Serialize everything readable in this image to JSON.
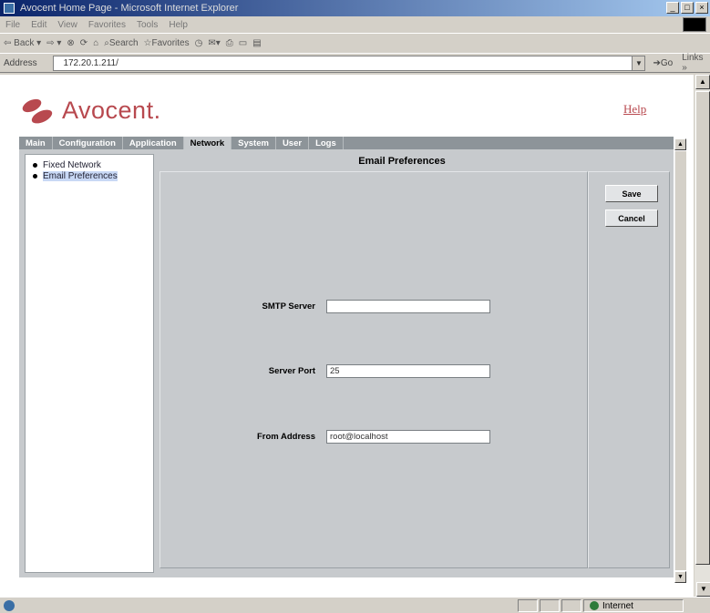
{
  "window": {
    "title": "Avocent Home Page - Microsoft Internet Explorer",
    "controls": [
      "_",
      "□",
      "×"
    ]
  },
  "menu": [
    "File",
    "Edit",
    "View",
    "Favorites",
    "Tools",
    "Help"
  ],
  "toolbar": {
    "back": "Back",
    "search": "Search",
    "favorites": "Favorites"
  },
  "address": {
    "label": "Address",
    "url": "172.20.1.211/",
    "go": "Go",
    "links": "Links »"
  },
  "header": {
    "brand": "Avocent.",
    "help": "Help"
  },
  "nav": {
    "tabs": [
      "Main",
      "Configuration",
      "Application",
      "Network",
      "System",
      "User",
      "Logs"
    ],
    "active": "Network"
  },
  "sidebar": {
    "items": [
      {
        "label": "Fixed Network"
      },
      {
        "label": "Email Preferences"
      }
    ]
  },
  "main": {
    "title": "Email Preferences",
    "fields": {
      "smtp": {
        "label": "SMTP Server",
        "value": ""
      },
      "port": {
        "label": "Server Port",
        "value": "25"
      },
      "from": {
        "label": "From Address",
        "value": "root@localhost"
      }
    }
  },
  "actions": {
    "save": "Save",
    "cancel": "Cancel"
  },
  "status": {
    "zone": "Internet"
  }
}
